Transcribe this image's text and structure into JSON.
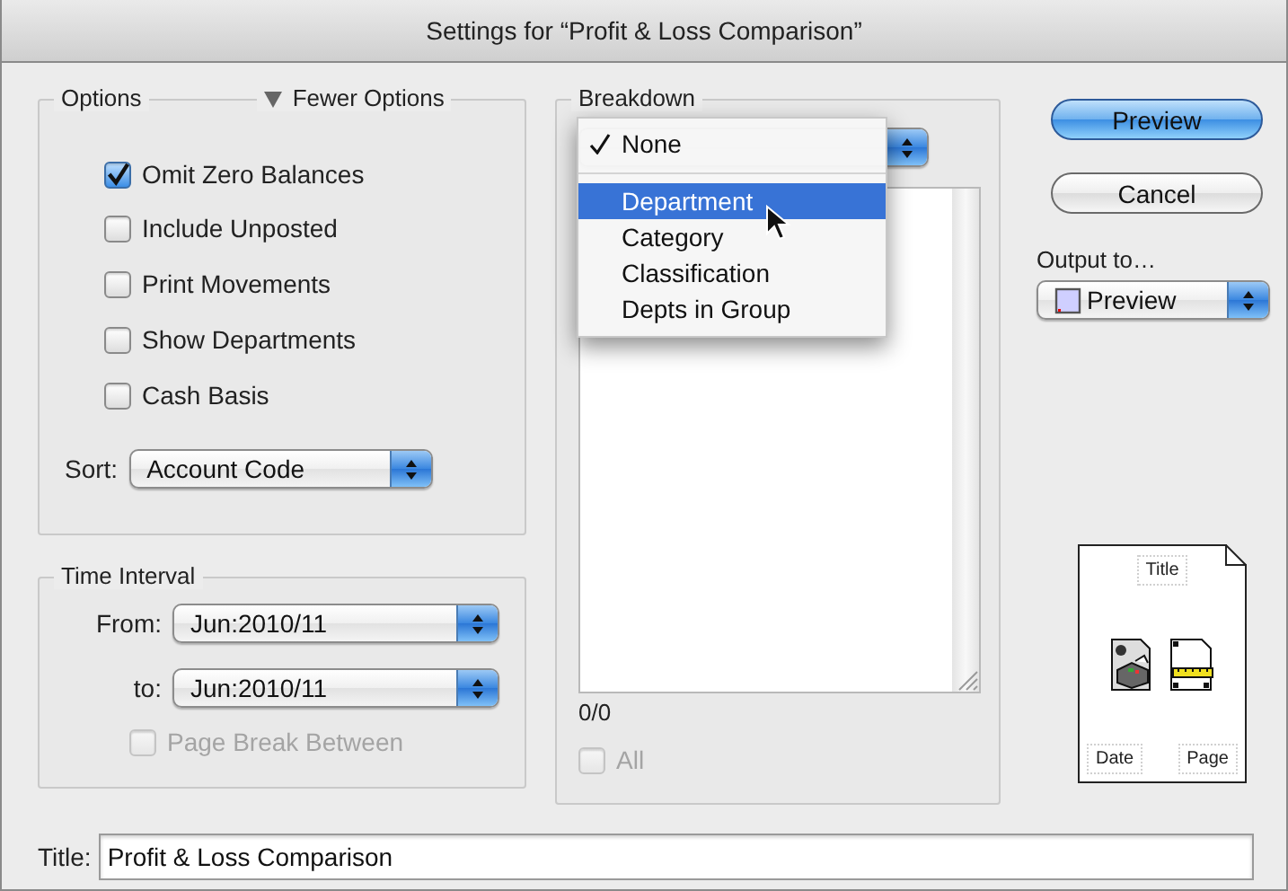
{
  "window": {
    "title": "Settings for “Profit & Loss Comparison”"
  },
  "options": {
    "label": "Options",
    "toggle": "Fewer Options",
    "expanded": true,
    "checkboxes": [
      {
        "label": "Omit Zero Balances",
        "checked": true
      },
      {
        "label": "Include Unposted",
        "checked": false
      },
      {
        "label": "Print Movements",
        "checked": false
      },
      {
        "label": "Show Departments",
        "checked": false
      },
      {
        "label": "Cash Basis",
        "checked": false
      }
    ],
    "sort": {
      "label": "Sort:",
      "value": "Account Code"
    }
  },
  "time_interval": {
    "label": "Time Interval",
    "from": {
      "label": "From:",
      "value": "Jun:2010/11"
    },
    "to": {
      "label": "to:",
      "value": "Jun:2010/11"
    },
    "page_break": {
      "label": "Page Break Between",
      "checked": false,
      "disabled": true
    }
  },
  "breakdown": {
    "label": "Breakdown",
    "menu": [
      {
        "kind": "item",
        "label": "None",
        "checked": true,
        "selected": false
      },
      {
        "kind": "separator"
      },
      {
        "kind": "item",
        "label": "Department",
        "checked": false,
        "selected": true
      },
      {
        "kind": "item",
        "label": "Category",
        "checked": false,
        "selected": false
      },
      {
        "kind": "item",
        "label": "Classification",
        "checked": false,
        "selected": false
      },
      {
        "kind": "item",
        "label": "Depts in Group",
        "checked": false,
        "selected": false
      }
    ],
    "count": "0/0",
    "all": {
      "label": "All",
      "checked": false,
      "disabled": true
    }
  },
  "buttons": [
    {
      "label": "Preview",
      "default": true
    },
    {
      "label": "Cancel",
      "default": false
    }
  ],
  "output": {
    "label": "Output to…",
    "value": "Preview"
  },
  "layout_preview": {
    "header": "Title",
    "footer_left": "Date",
    "footer_right": "Page"
  },
  "title_field": {
    "label": "Title:",
    "value": "Profit & Loss Comparison"
  }
}
